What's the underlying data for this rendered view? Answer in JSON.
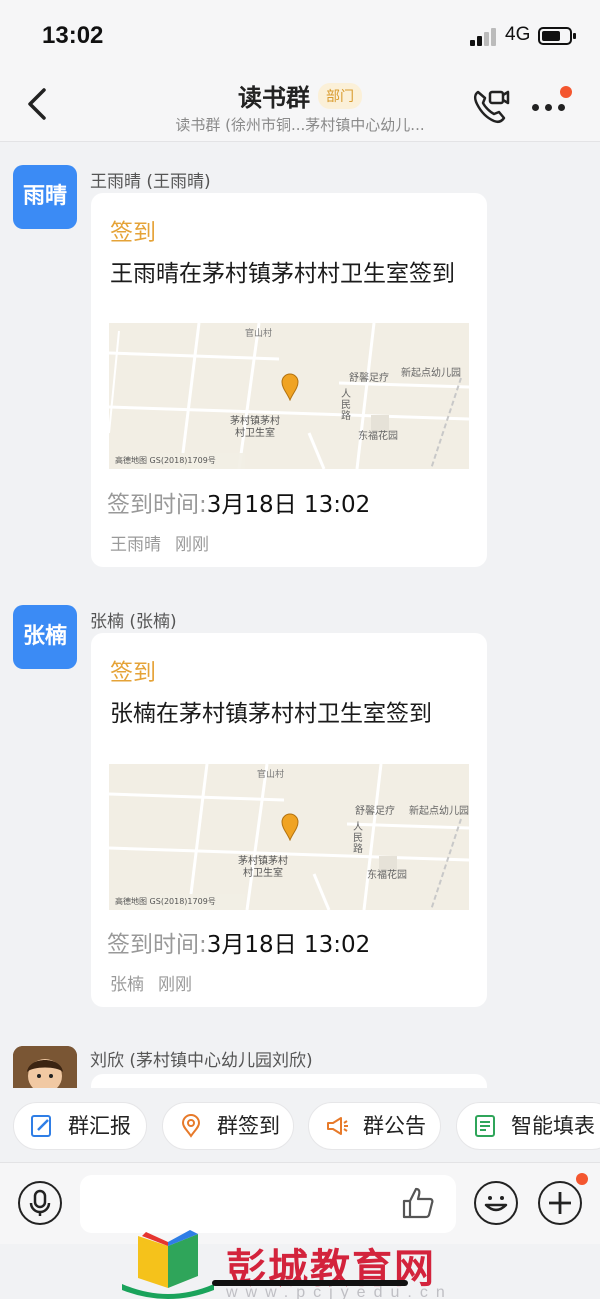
{
  "status": {
    "time": "13:02",
    "network": "4G"
  },
  "header": {
    "title": "读书群",
    "tag": "部门",
    "subtitle": "读书群 (徐州市铜...茅村镇中心幼儿..."
  },
  "messages": [
    {
      "avatar_text": "雨晴",
      "sender": "王雨晴 (王雨晴)",
      "type": "签到",
      "text": "王雨晴在茅村镇茅村村卫生室签到",
      "map": {
        "village": "官山村",
        "shop": "舒馨足疗",
        "kindergarten": "新起点幼儿园",
        "road": "人民路",
        "clinic": "茅村镇茅村村卫生室",
        "garden": "东福花园",
        "copyright": "高德地图 GS(2018)1709号"
      },
      "time_label": "签到时间:",
      "time_value": "3月18日 13:02",
      "footer_name": "王雨晴",
      "footer_time": "刚刚"
    },
    {
      "avatar_text": "张楠",
      "sender": "张楠 (张楠)",
      "type": "签到",
      "text": "张楠在茅村镇茅村村卫生室签到",
      "map": {
        "village": "官山村",
        "shop": "舒馨足疗",
        "kindergarten": "新起点幼儿园",
        "road": "人民路",
        "clinic": "茅村镇茅村村卫生室",
        "garden": "东福花园",
        "copyright": "高德地图 GS(2018)1709号"
      },
      "time_label": "签到时间:",
      "time_value": "3月18日 13:02",
      "footer_name": "张楠",
      "footer_time": "刚刚"
    },
    {
      "sender": "刘欣 (茅村镇中心幼儿园刘欣)"
    }
  ],
  "quick_actions": [
    "群汇报",
    "群签到",
    "群公告",
    "智能填表"
  ],
  "watermark": {
    "text": "彭城教育网",
    "url": "www.pcjyedu.cn"
  },
  "colors": {
    "accent": "#3b8bf5",
    "checkin": "#e5a338",
    "badge": "#f4562f",
    "brand": "#d3233c"
  }
}
